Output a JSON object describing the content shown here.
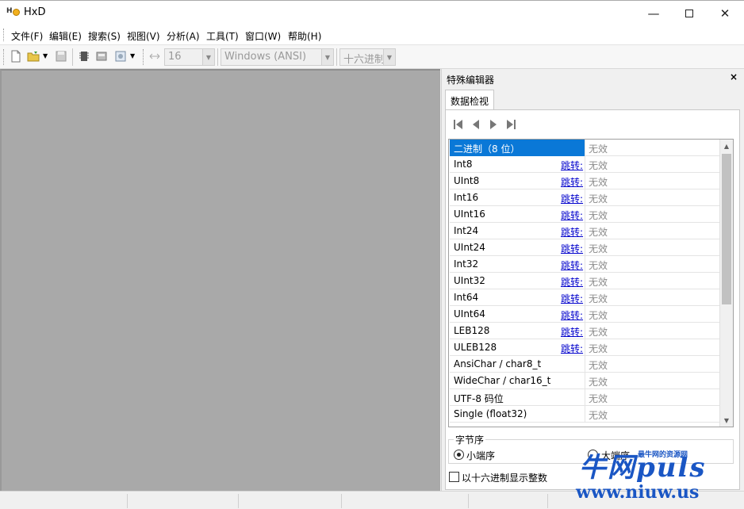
{
  "window": {
    "title": "HxD"
  },
  "menu": [
    "文件(F)",
    "编辑(E)",
    "搜索(S)",
    "视图(V)",
    "分析(A)",
    "工具(T)",
    "窗口(W)",
    "帮助(H)"
  ],
  "toolbar": {
    "bytes_per_row": "16",
    "charset": "Windows (ANSI)",
    "offset_base": "十六进制"
  },
  "panel": {
    "title": "特殊编辑器",
    "close": "×",
    "tab": "数据检视",
    "rows": [
      {
        "name": "二进制（8 位）",
        "jump": "",
        "value": "无效"
      },
      {
        "name": "Int8",
        "jump": "跳转:",
        "value": "无效"
      },
      {
        "name": "UInt8",
        "jump": "跳转:",
        "value": "无效"
      },
      {
        "name": "Int16",
        "jump": "跳转:",
        "value": "无效"
      },
      {
        "name": "UInt16",
        "jump": "跳转:",
        "value": "无效"
      },
      {
        "name": "Int24",
        "jump": "跳转:",
        "value": "无效"
      },
      {
        "name": "UInt24",
        "jump": "跳转:",
        "value": "无效"
      },
      {
        "name": "Int32",
        "jump": "跳转:",
        "value": "无效"
      },
      {
        "name": "UInt32",
        "jump": "跳转:",
        "value": "无效"
      },
      {
        "name": "Int64",
        "jump": "跳转:",
        "value": "无效"
      },
      {
        "name": "UInt64",
        "jump": "跳转:",
        "value": "无效"
      },
      {
        "name": "LEB128",
        "jump": "跳转:",
        "value": "无效"
      },
      {
        "name": "ULEB128",
        "jump": "跳转:",
        "value": "无效"
      },
      {
        "name": "AnsiChar / char8_t",
        "jump": "",
        "value": "无效"
      },
      {
        "name": "WideChar / char16_t",
        "jump": "",
        "value": "无效"
      },
      {
        "name": "UTF-8 码位",
        "jump": "",
        "value": "无效"
      },
      {
        "name": "Single (float32)",
        "jump": "",
        "value": "无效"
      }
    ],
    "byte_order": {
      "label": "字节序",
      "little_endian": "小端序",
      "big_endian": "大端序"
    },
    "hex_checkbox": "以十六进制显示整数"
  },
  "watermark": {
    "big": "牛网puls",
    "small": "最牛网的资源网",
    "url": "www.niuw.us"
  }
}
